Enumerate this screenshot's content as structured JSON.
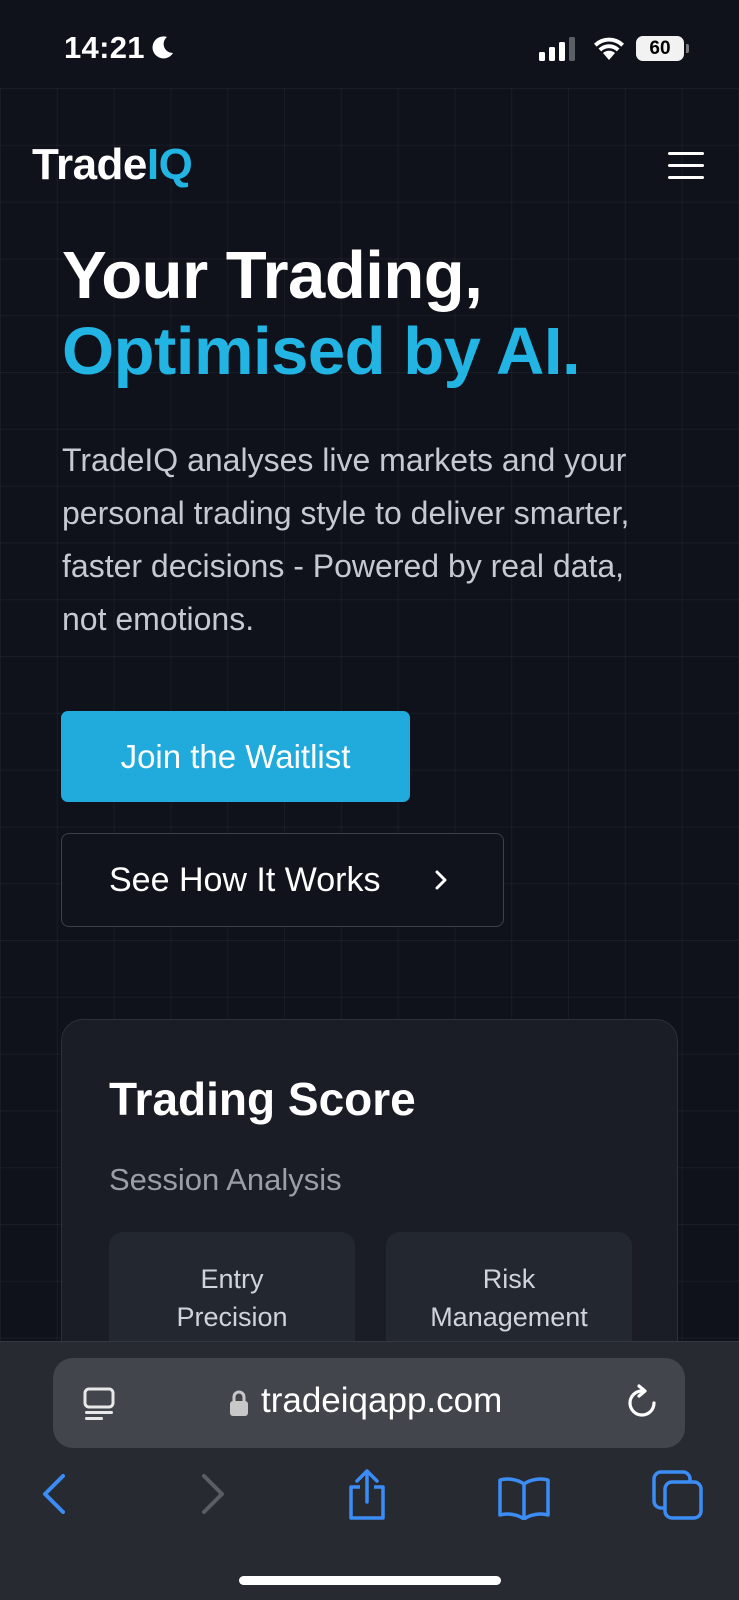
{
  "status_bar": {
    "time": "14:21",
    "battery": "60",
    "icons": [
      "moon-icon",
      "cellular-signal-icon",
      "wifi-icon",
      "battery-icon"
    ]
  },
  "header": {
    "logo_main": "Trade",
    "logo_accent": "IQ",
    "menu_icon": "hamburger-menu-icon"
  },
  "hero": {
    "title_line1": "Your Trading,",
    "title_line2": "Optimised by AI.",
    "description": "TradeIQ analyses live markets and your personal trading style to deliver smarter, faster decisions - Powered by real data, not emotions.",
    "primary_button": "Join the Waitlist",
    "secondary_button": "See How It Works"
  },
  "card": {
    "title": "Trading Score",
    "subtitle": "Session Analysis",
    "metrics": [
      {
        "label": "Entry Precision"
      },
      {
        "label": "Risk Management"
      }
    ]
  },
  "browser": {
    "url": "tradeiqapp.com",
    "toolbar_icons": [
      "back-icon",
      "forward-icon",
      "share-icon",
      "bookmarks-icon",
      "tabs-icon"
    ]
  },
  "colors": {
    "background": "#0f121a",
    "accent": "#22b4e3",
    "button": "#21abdc",
    "card": "#1a1d25"
  }
}
